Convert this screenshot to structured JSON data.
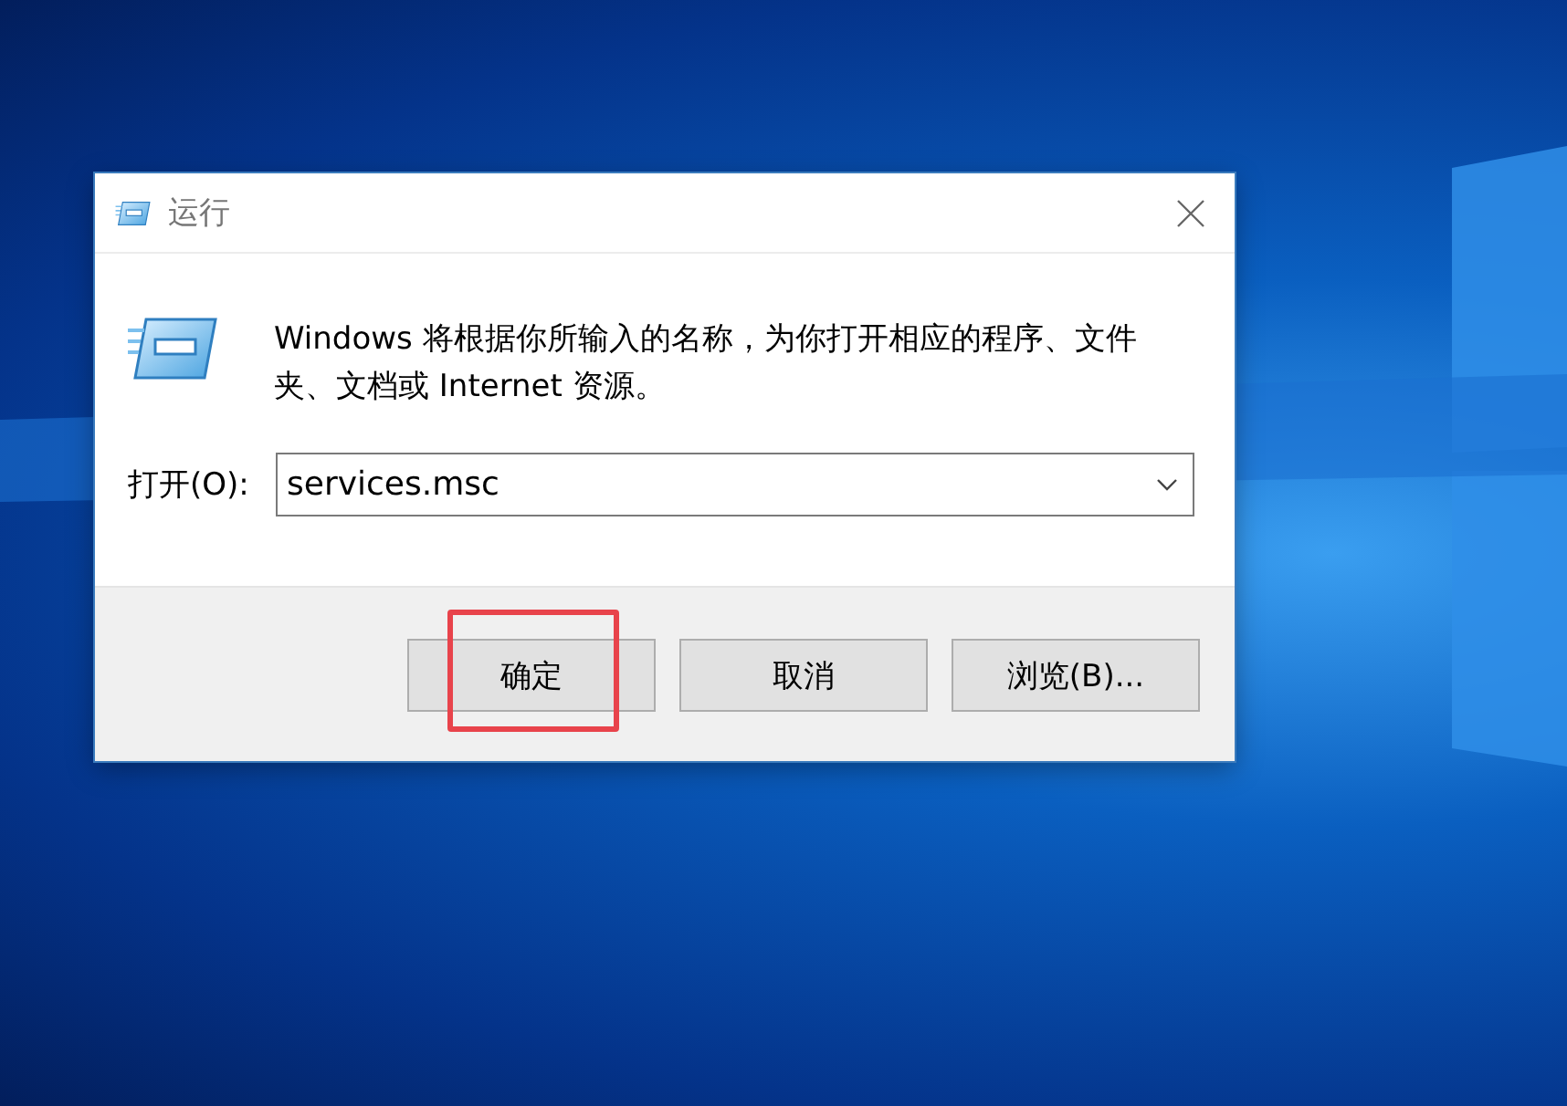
{
  "window": {
    "title": "运行"
  },
  "message": "Windows 将根据你所输入的名称，为你打开相应的程序、文件夹、文档或 Internet 资源。",
  "open_field": {
    "label": "打开(O):",
    "value": "services.msc"
  },
  "buttons": [
    {
      "label": "确定",
      "highlighted": true
    },
    {
      "label": "取消",
      "highlighted": false
    },
    {
      "label": "浏览(B)...",
      "highlighted": false
    }
  ]
}
